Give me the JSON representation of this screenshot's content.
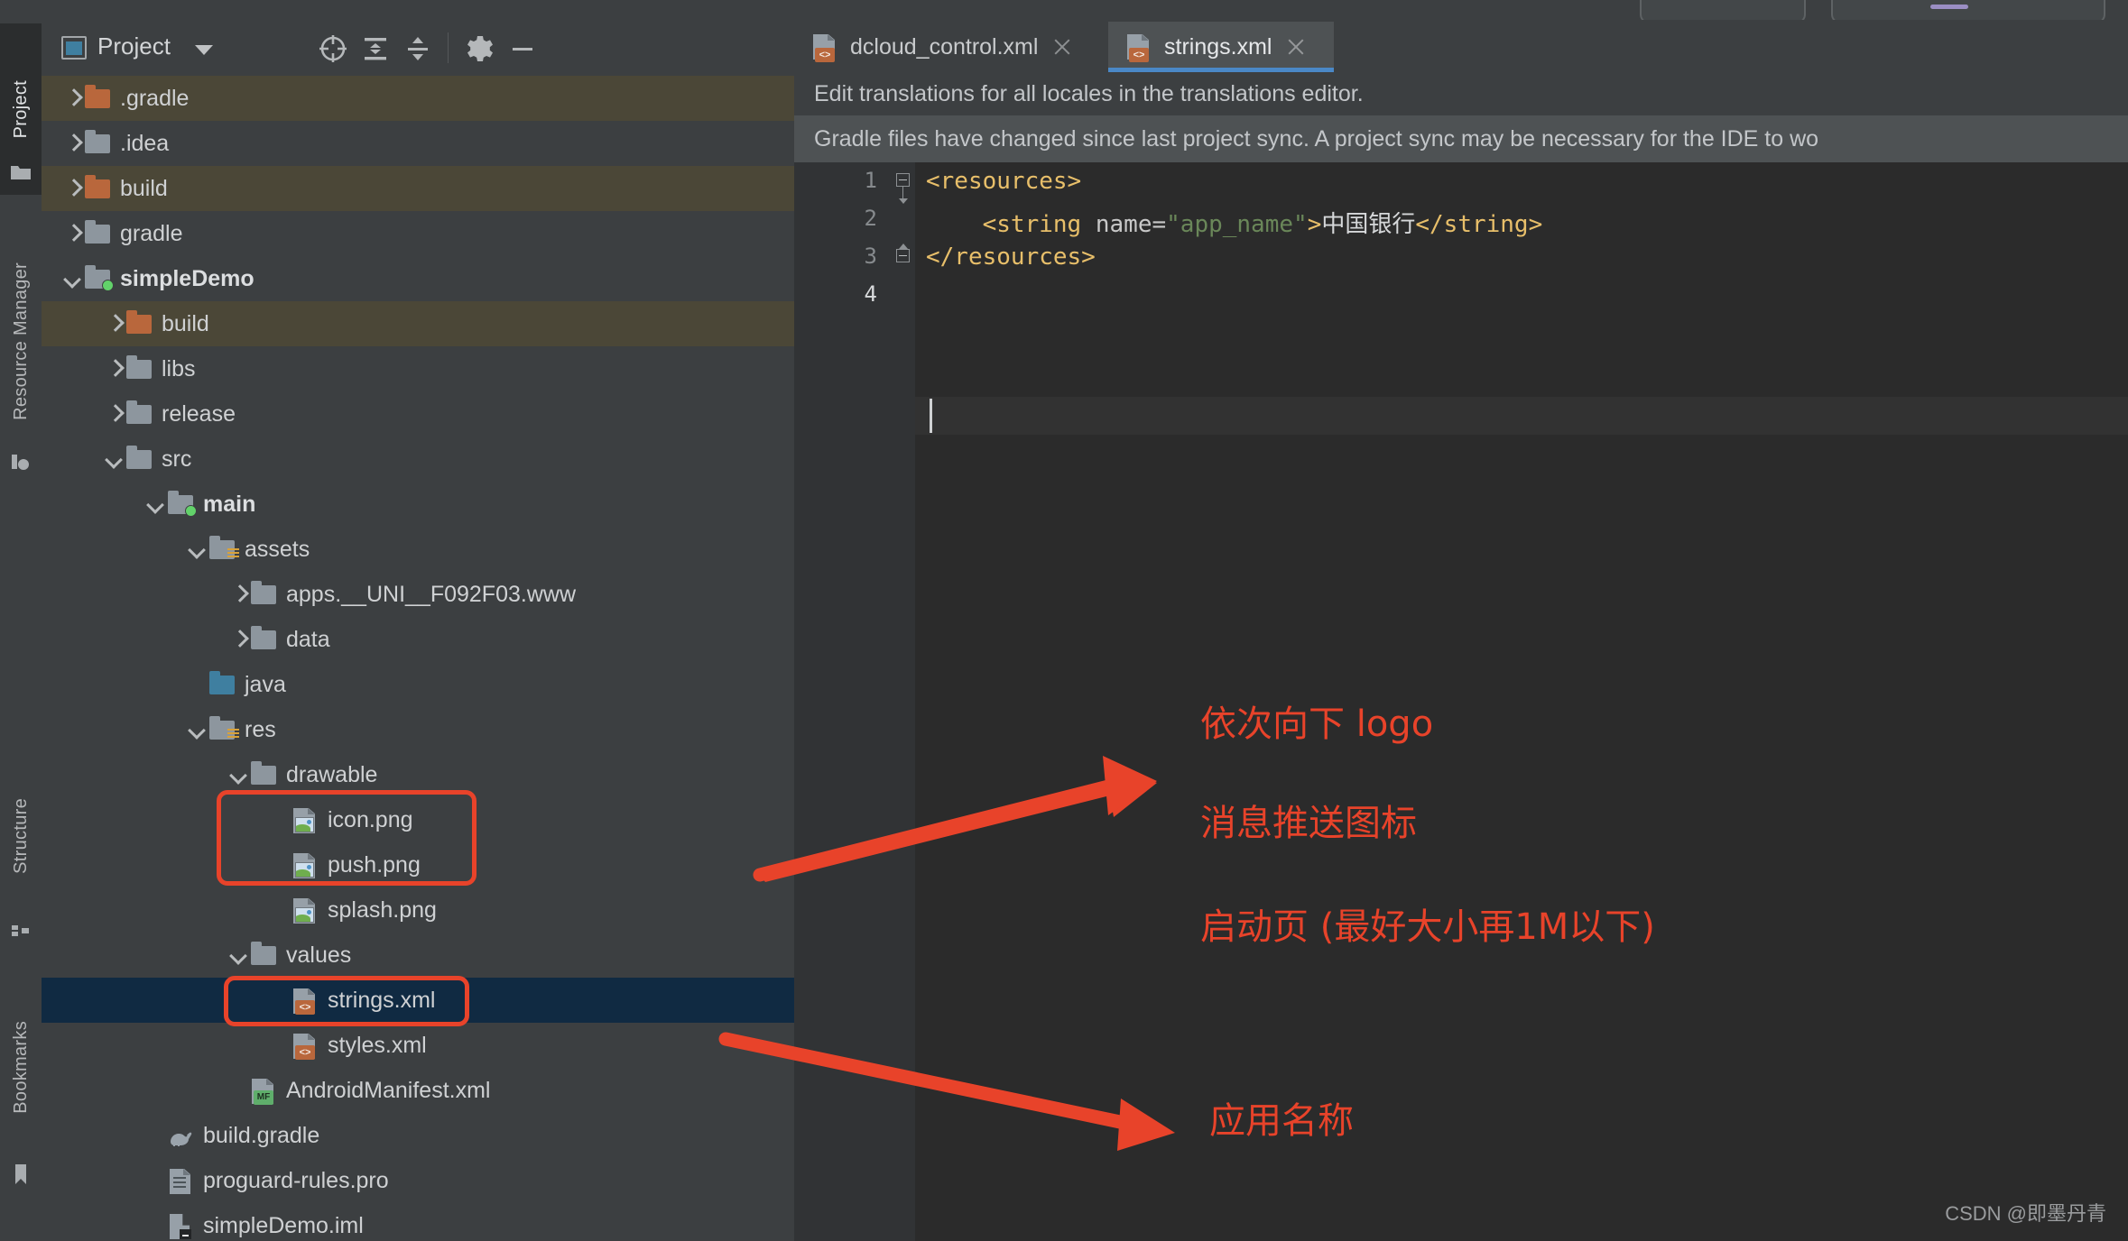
{
  "window": {
    "tool_rail": [
      {
        "label": "Project",
        "icon": "folder-icon",
        "active": true
      },
      {
        "label": "Resource Manager",
        "icon": "resource-icon",
        "active": false
      },
      {
        "label": "Structure",
        "icon": "structure-icon",
        "active": false
      },
      {
        "label": "Bookmarks",
        "icon": "bookmark-icon",
        "active": false
      }
    ]
  },
  "project_panel": {
    "title": "Project",
    "icon": "project-view-icon",
    "dropdown_icon": "chevron-down-icon",
    "toolbar": [
      {
        "name": "select-opened-file-icon",
        "label": "Select Opened File"
      },
      {
        "name": "expand-all-icon",
        "label": "Expand All"
      },
      {
        "name": "collapse-all-icon",
        "label": "Collapse All"
      },
      {
        "name": "settings-gear-icon",
        "label": "Settings"
      },
      {
        "name": "hide-panel-icon",
        "label": "Hide"
      }
    ],
    "tree": [
      {
        "label": ".gradle",
        "indent": 0,
        "toggle": "closed",
        "icon": "folder-orange",
        "excluded": true
      },
      {
        "label": ".idea",
        "indent": 0,
        "toggle": "closed",
        "icon": "folder",
        "excluded": false
      },
      {
        "label": "build",
        "indent": 0,
        "toggle": "closed",
        "icon": "folder-orange",
        "excluded": true
      },
      {
        "label": "gradle",
        "indent": 0,
        "toggle": "closed",
        "icon": "folder",
        "excluded": false
      },
      {
        "label": "simpleDemo",
        "indent": 0,
        "toggle": "open",
        "icon": "folder-module",
        "bold": true,
        "excluded": false
      },
      {
        "label": "build",
        "indent": 1,
        "toggle": "closed",
        "icon": "folder-orange",
        "excluded": true
      },
      {
        "label": "libs",
        "indent": 1,
        "toggle": "closed",
        "icon": "folder",
        "excluded": false
      },
      {
        "label": "release",
        "indent": 1,
        "toggle": "closed",
        "icon": "folder",
        "excluded": false
      },
      {
        "label": "src",
        "indent": 1,
        "toggle": "open",
        "icon": "folder",
        "excluded": false
      },
      {
        "label": "main",
        "indent": 2,
        "toggle": "open",
        "icon": "folder-source",
        "bold": true,
        "excluded": false
      },
      {
        "label": "assets",
        "indent": 3,
        "toggle": "open",
        "icon": "folder-res",
        "excluded": false
      },
      {
        "label": "apps.__UNI__F092F03.www",
        "indent": 4,
        "toggle": "closed",
        "icon": "folder",
        "excluded": false
      },
      {
        "label": "data",
        "indent": 4,
        "toggle": "closed",
        "icon": "folder",
        "excluded": false
      },
      {
        "label": "java",
        "indent": 3,
        "toggle": "none",
        "icon": "folder-blue",
        "excluded": false
      },
      {
        "label": "res",
        "indent": 3,
        "toggle": "open",
        "icon": "folder-res",
        "excluded": false
      },
      {
        "label": "drawable",
        "indent": 4,
        "toggle": "open",
        "icon": "folder",
        "excluded": false
      },
      {
        "label": "icon.png",
        "indent": 5,
        "toggle": "none",
        "icon": "image-file",
        "excluded": false
      },
      {
        "label": "push.png",
        "indent": 5,
        "toggle": "none",
        "icon": "image-file",
        "excluded": false
      },
      {
        "label": "splash.png",
        "indent": 5,
        "toggle": "none",
        "icon": "image-file",
        "excluded": false
      },
      {
        "label": "values",
        "indent": 4,
        "toggle": "open",
        "icon": "folder",
        "excluded": false
      },
      {
        "label": "strings.xml",
        "indent": 5,
        "toggle": "none",
        "icon": "xml-file",
        "selected": true,
        "excluded": false
      },
      {
        "label": "styles.xml",
        "indent": 5,
        "toggle": "none",
        "icon": "xml-file",
        "excluded": false
      },
      {
        "label": "AndroidManifest.xml",
        "indent": 4,
        "toggle": "none",
        "icon": "manifest-file",
        "excluded": false
      },
      {
        "label": "build.gradle",
        "indent": 2,
        "toggle": "none",
        "icon": "gradle-file",
        "excluded": false
      },
      {
        "label": "proguard-rules.pro",
        "indent": 2,
        "toggle": "none",
        "icon": "pro-file",
        "excluded": false
      },
      {
        "label": "simpleDemo.iml",
        "indent": 2,
        "toggle": "none",
        "icon": "iml-file",
        "excluded": false
      }
    ]
  },
  "editor": {
    "tabs": [
      {
        "label": "dcloud_control.xml",
        "icon": "xml-file-icon",
        "active": false,
        "close_icon": "close-icon"
      },
      {
        "label": "strings.xml",
        "icon": "xml-file-icon",
        "active": true,
        "close_icon": "close-icon"
      }
    ],
    "banners": [
      {
        "text": "Edit translations for all locales in the translations editor."
      },
      {
        "text": "Gradle files have changed since last project sync. A project sync may be necessary for the IDE to wo"
      }
    ],
    "line_numbers": [
      "1",
      "2",
      "3",
      "4"
    ],
    "current_line": "4",
    "code": {
      "line1": {
        "tag_open": "<resources>"
      },
      "line2": {
        "tag": "<string ",
        "attr": "name=",
        "value": "\"app_name\"",
        "gt": ">",
        "text": "中国银行",
        "tag_close": "</string>"
      },
      "line3": {
        "tag_close": "</resources>"
      }
    }
  },
  "annotations": {
    "notes": [
      {
        "text": "依次向下 logo"
      },
      {
        "text": "消息推送图标"
      },
      {
        "text": "启动页 (最好大小再1M以下)"
      },
      {
        "text": "应用名称"
      }
    ],
    "highlight_color": "#e8432a"
  },
  "watermark": {
    "text": "CSDN @即墨丹青"
  }
}
